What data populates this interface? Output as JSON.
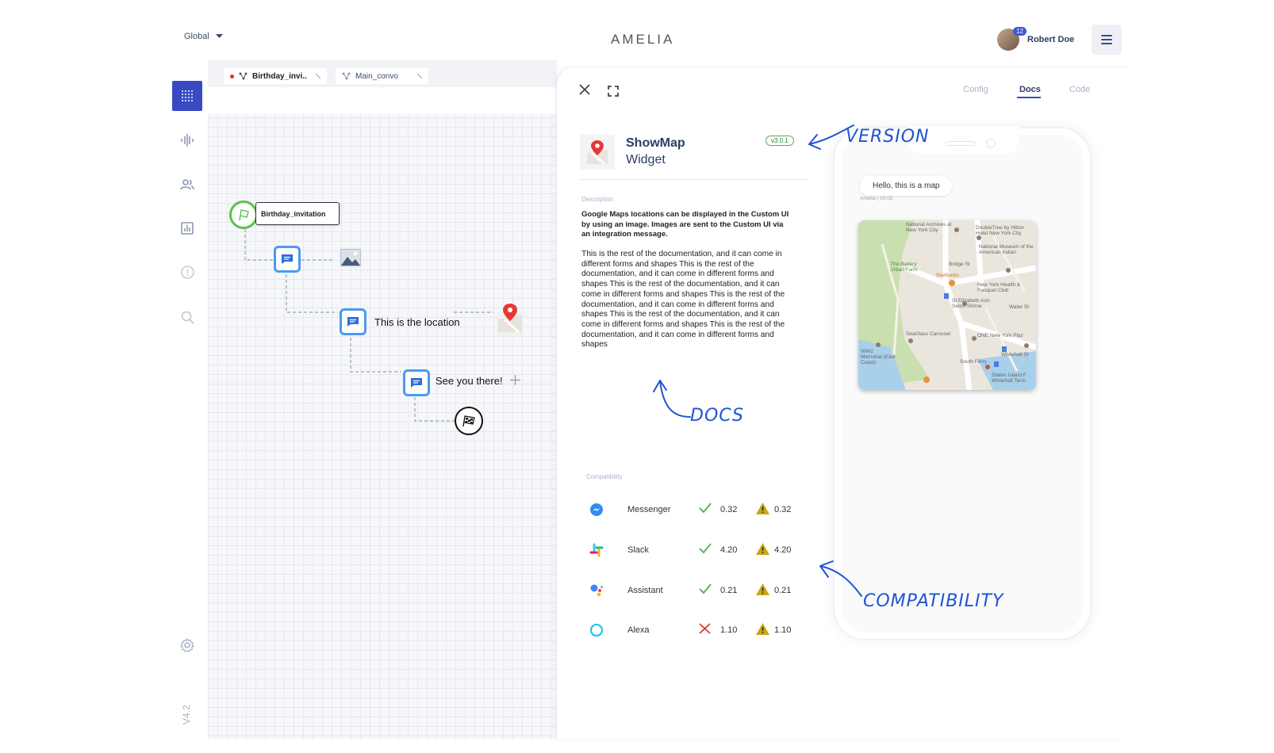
{
  "header": {
    "workspace": "Global",
    "logo": "AMELIA",
    "user_name": "Robert Doe",
    "notification_count": "12"
  },
  "sidebar": {
    "version": "V4.2",
    "items": [
      "grid-icon",
      "waveform-icon",
      "users-icon",
      "chart-icon",
      "alert-icon",
      "search-icon",
      "gear-icon"
    ]
  },
  "tabs": [
    {
      "label": "Birthday_invi..",
      "unsaved": true
    },
    {
      "label": "Main_convo",
      "unsaved": false
    }
  ],
  "flow": {
    "start_label": "Birthday_invitation",
    "node2_text": "This is the location",
    "node3_text": "See you there!"
  },
  "panel": {
    "tabs": [
      "Config",
      "Docs",
      "Code"
    ],
    "active_tab": "Docs",
    "widget_name": "ShowMap",
    "widget_type": "Widget",
    "version": "v3.0.1",
    "description_label": "Description",
    "description_bold": "Google Maps locations can be displayed in the Custom UI by using an image. Images are sent to the Custom UI via an integration message.",
    "description_body": "This is the rest of the documentation, and it can come in different forms and shapes This is the rest of the documentation, and it can come in different forms and shapes This is the rest of the documentation, and it can come in different forms and shapes This is the rest of the documentation, and it can come in different forms and shapes This is the rest of the documentation, and it can come in different forms and shapes This is the rest of the documentation, and it can come in different forms and shapes",
    "compatibility_label": "Compatibility",
    "compatibility": [
      {
        "channel": "Messenger",
        "supported": true,
        "version": "0.32",
        "warn_version": "0.32"
      },
      {
        "channel": "Slack",
        "supported": true,
        "version": "4.20",
        "warn_version": "4.20"
      },
      {
        "channel": "Assistant",
        "supported": true,
        "version": "0.21",
        "warn_version": "0.21"
      },
      {
        "channel": "Alexa",
        "supported": false,
        "version": "1.10",
        "warn_version": "1.10"
      }
    ]
  },
  "preview": {
    "bubble_text": "Hello, this is a map",
    "bubble_meta": "Amelia | 10:02",
    "map_labels": [
      "National Archives at New York City",
      "DoubleTree by Hilton Hotel New York City",
      "National Museum of the American Indian",
      "The Battery Urban Farm",
      "Bridge St",
      "Starbucks",
      "New York Health & Racquet Club",
      "St Elizabeth Ann Seton Shrine",
      "Water St",
      "SeaGlass Carousel",
      "ONE New York Plaz",
      "WW2 Memorial (East Coast)",
      "South Ferry",
      "Whitehall St",
      "Staten Island F Whitehall Term"
    ]
  },
  "annotations": {
    "version": "VERSION",
    "docs": "DOCS",
    "compatibility": "COMPATIBILITY"
  },
  "colors": {
    "accent": "#3949c2",
    "start_node": "#5ac24d",
    "chat_node": "#4a9af2",
    "annotation": "#1f54d3",
    "success": "#4caf50",
    "error": "#e53935",
    "warning": "#c9a616"
  }
}
